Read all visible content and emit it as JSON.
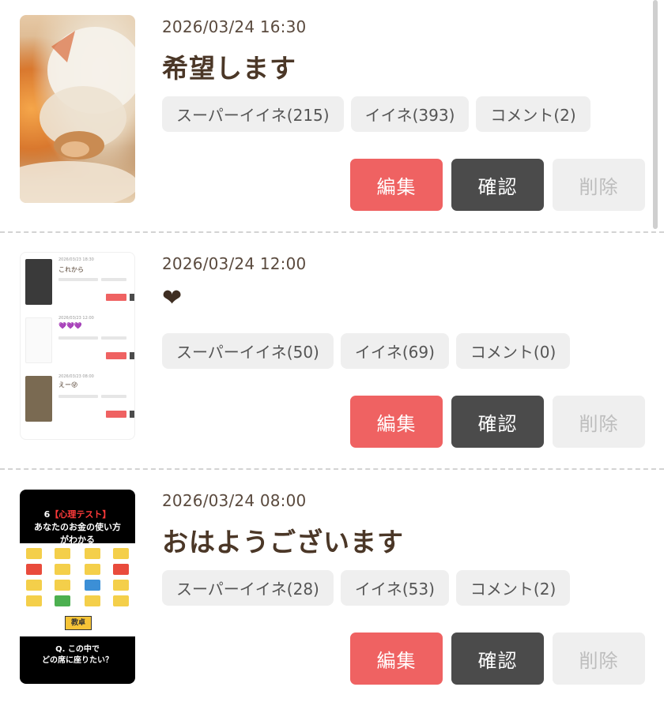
{
  "posts": [
    {
      "timestamp": "2026/03/24 16:30",
      "title": "希望します",
      "chips": [
        "スーパーイイネ(215)",
        "イイネ(393)",
        "コメント(2)"
      ],
      "buttons": {
        "edit": "編集",
        "confirm": "確認",
        "delete": "削除"
      }
    },
    {
      "timestamp": "2026/03/24 12:00",
      "title": "❤",
      "chips": [
        "スーパーイイネ(50)",
        "イイネ(69)",
        "コメント(0)"
      ],
      "buttons": {
        "edit": "編集",
        "confirm": "確認",
        "delete": "削除"
      },
      "thumbnail_text": [
        "2026/03/23 18:30",
        "これから",
        "2026/03/23 12:00",
        "💜💜💜",
        "2026/03/23 08:00",
        "えー😜"
      ]
    },
    {
      "timestamp": "2026/03/24 08:00",
      "title": "おはようございます",
      "chips": [
        "スーパーイイネ(28)",
        "イイネ(53)",
        "コメント(2)"
      ],
      "buttons": {
        "edit": "編集",
        "confirm": "確認",
        "delete": "削除"
      },
      "thumbnail_text": {
        "num": "6",
        "tag": "【心理テスト】",
        "line1": "あなたのお金の使い方",
        "line2": "がわかる",
        "podium": "教卓",
        "q1": "Q. この中で",
        "q2": "どの席に座りたい？"
      }
    }
  ],
  "colors": {
    "edit": "#ef6262",
    "confirm": "#4b4b4b",
    "delete": "#efefef",
    "chip": "#efefef",
    "title": "#4b3727"
  }
}
